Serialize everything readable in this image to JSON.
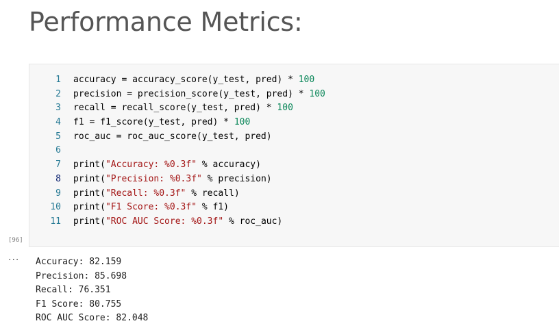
{
  "markdown": {
    "heading": "Performance Metrics:"
  },
  "cell": {
    "execution_count": "[96]",
    "lines": [
      {
        "n": "1",
        "segments": [
          [
            "t",
            "accuracy = accuracy_score(y_test, pred) * "
          ],
          [
            "n",
            "100"
          ]
        ]
      },
      {
        "n": "2",
        "segments": [
          [
            "t",
            "precision = precision_score(y_test, pred) * "
          ],
          [
            "n",
            "100"
          ]
        ]
      },
      {
        "n": "3",
        "segments": [
          [
            "t",
            "recall = recall_score(y_test, pred) * "
          ],
          [
            "n",
            "100"
          ]
        ]
      },
      {
        "n": "4",
        "segments": [
          [
            "t",
            "f1 = f1_score(y_test, pred) * "
          ],
          [
            "n",
            "100"
          ]
        ]
      },
      {
        "n": "5",
        "segments": [
          [
            "t",
            "roc_auc = roc_auc_score(y_test, pred)"
          ]
        ]
      },
      {
        "n": "6",
        "segments": []
      },
      {
        "n": "7",
        "segments": [
          [
            "t",
            "print("
          ],
          [
            "s",
            "\"Accuracy: %0.3f\""
          ],
          [
            "t",
            " % accuracy)"
          ]
        ]
      },
      {
        "n": "8",
        "segments": [
          [
            "t",
            "print("
          ],
          [
            "s",
            "\"Precision: %0.3f\""
          ],
          [
            "t",
            " % precision)"
          ]
        ]
      },
      {
        "n": "9",
        "segments": [
          [
            "t",
            "print("
          ],
          [
            "s",
            "\"Recall: %0.3f\""
          ],
          [
            "t",
            " % recall)"
          ]
        ]
      },
      {
        "n": "10",
        "segments": [
          [
            "t",
            "print("
          ],
          [
            "s",
            "\"F1 Score: %0.3f\""
          ],
          [
            "t",
            " % f1)"
          ]
        ]
      },
      {
        "n": "11",
        "segments": [
          [
            "t",
            "print("
          ],
          [
            "s",
            "\"ROC AUC Score: %0.3f\""
          ],
          [
            "t",
            " % roc_auc)"
          ]
        ]
      }
    ]
  },
  "output": {
    "dots": "···",
    "lines": [
      "Accuracy: 82.159",
      "Precision: 85.698",
      "Recall: 76.351",
      "F1 Score: 80.755",
      "ROC AUC Score: 82.048"
    ]
  }
}
